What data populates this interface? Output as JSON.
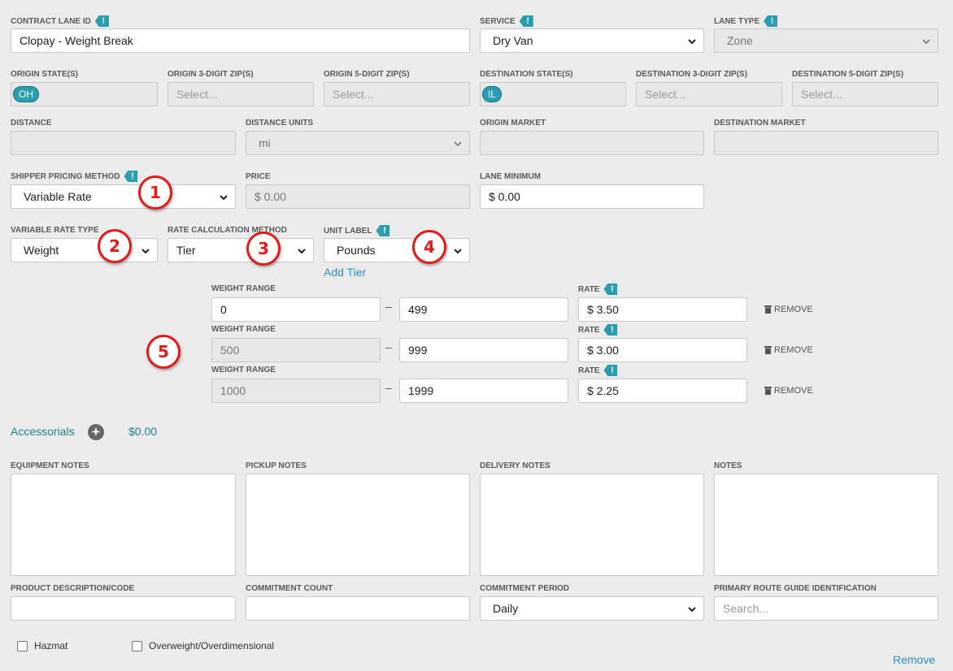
{
  "row1": {
    "contract_lane_id": {
      "label": "CONTRACT LANE ID",
      "value": "Clopay - Weight Break"
    },
    "service": {
      "label": "SERVICE",
      "value": "Dry Van"
    },
    "lane_type": {
      "label": "LANE TYPE",
      "value": "Zone"
    }
  },
  "row2": {
    "origin_states": {
      "label": "ORIGIN STATE(S)",
      "chip": "OH"
    },
    "origin_3zip": {
      "label": "ORIGIN 3-DIGIT ZIP(S)",
      "placeholder": "Select..."
    },
    "origin_5zip": {
      "label": "ORIGIN 5-DIGIT ZIP(S)",
      "placeholder": "Select..."
    },
    "dest_states": {
      "label": "DESTINATION STATE(S)",
      "chip": "IL"
    },
    "dest_3zip": {
      "label": "DESTINATION 3-DIGIT ZIP(S)",
      "placeholder": "Select..."
    },
    "dest_5zip": {
      "label": "DESTINATION 5-DIGIT ZIP(S)",
      "placeholder": "Select..."
    }
  },
  "row3": {
    "distance": {
      "label": "DISTANCE",
      "value": ""
    },
    "distance_units": {
      "label": "DISTANCE UNITS",
      "value": "mi"
    },
    "origin_market": {
      "label": "ORIGIN MARKET",
      "value": ""
    },
    "destination_market": {
      "label": "DESTINATION MARKET",
      "value": ""
    }
  },
  "row4": {
    "shipper_pricing_method": {
      "label": "SHIPPER PRICING METHOD",
      "value": "Variable Rate"
    },
    "price": {
      "label": "PRICE",
      "value": "$ 0.00"
    },
    "lane_minimum": {
      "label": "LANE MINIMUM",
      "value": "$ 0.00"
    }
  },
  "row5": {
    "variable_rate_type": {
      "label": "VARIABLE RATE TYPE",
      "value": "Weight"
    },
    "rate_calc_method": {
      "label": "RATE CALCULATION METHOD",
      "value": "Tier"
    },
    "unit_label": {
      "label": "UNIT LABEL",
      "value": "Pounds"
    },
    "add_tier": "Add Tier"
  },
  "tiers": [
    {
      "range_label": "WEIGHT RANGE",
      "from": "0",
      "to": "499",
      "rate_label": "RATE",
      "rate": "$ 3.50",
      "remove": "REMOVE"
    },
    {
      "range_label": "WEIGHT RANGE",
      "from": "500",
      "to": "999",
      "rate_label": "RATE",
      "rate": "$ 3.00",
      "remove": "REMOVE"
    },
    {
      "range_label": "WEIGHT RANGE",
      "from": "1000",
      "to": "1999",
      "rate_label": "RATE",
      "rate": "$ 2.25",
      "remove": "REMOVE"
    }
  ],
  "tier_dash": "–",
  "hint_glyph": "!",
  "accessorials": {
    "label": "Accessorials",
    "amount": "$0.00"
  },
  "notes": {
    "equipment": "EQUIPMENT NOTES",
    "pickup": "PICKUP NOTES",
    "delivery": "DELIVERY NOTES",
    "notes": "NOTES"
  },
  "row_bottom": {
    "product_desc": {
      "label": "PRODUCT DESCRIPTION/CODE",
      "value": ""
    },
    "commitment_count": {
      "label": "COMMITMENT COUNT",
      "value": ""
    },
    "commitment_period": {
      "label": "COMMITMENT PERIOD",
      "value": "Daily"
    },
    "route_guide": {
      "label": "PRIMARY ROUTE GUIDE IDENTIFICATION",
      "placeholder": "Search..."
    }
  },
  "checkboxes": {
    "hazmat": "Hazmat",
    "overweight": "Overweight/Overdimensional"
  },
  "remove_link": "Remove",
  "badges": [
    "1",
    "2",
    "3",
    "4",
    "5"
  ],
  "colors": {
    "accent": "#2a9db0",
    "link": "#2a8fd0",
    "annotation": "#e31b1b",
    "background": "#ececec"
  }
}
